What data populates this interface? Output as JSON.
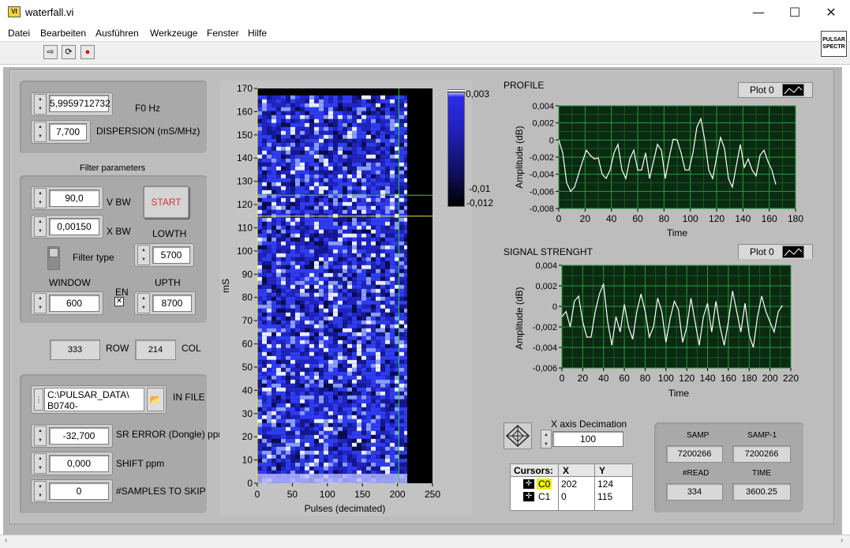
{
  "window": {
    "title": "waterfall.vi",
    "app_icon_text": "VI",
    "minimize": "—",
    "maximize": "☐",
    "close": "✕"
  },
  "menu": [
    "Datei",
    "Bearbeiten",
    "Ausführen",
    "Werkzeuge",
    "Fenster",
    "Hilfe"
  ],
  "toolbar": {
    "run": "⇨",
    "run_continuous": "⟳",
    "abort": "●"
  },
  "logo": {
    "line1": "PULSAR",
    "line2": "SPECTR"
  },
  "left": {
    "f0": {
      "value": "5,9959712732",
      "label": "F0 Hz"
    },
    "dispersion": {
      "value": "7,700",
      "label": "DISPERSION (mS/MHz)"
    },
    "filter_title": "Filter parameters",
    "vbw": {
      "value": "90,0",
      "label": "V BW"
    },
    "xbw": {
      "value": "0,00150",
      "label": "X BW"
    },
    "start": "START",
    "lowth": {
      "value": "5700",
      "label": "LOWTH"
    },
    "filter_type": "Filter type",
    "window": {
      "value": "600",
      "label": "WINDOW"
    },
    "en": {
      "label": "EN",
      "mark": "✕"
    },
    "upth": {
      "value": "8700",
      "label": "UPTH"
    },
    "row": {
      "value": "333",
      "label": "ROW"
    },
    "col": {
      "value": "214",
      "label": "COL"
    },
    "in_file": {
      "line1": "C:\\PULSAR_DATA\\",
      "line2": "B0740-",
      "label": "IN FILE",
      "browse": "📂"
    },
    "sr_error": {
      "value": "-32,700",
      "label": "SR ERROR (Dongle) ppm"
    },
    "shift": {
      "value": "0,000",
      "label": "SHIFT ppm"
    },
    "skip": {
      "value": "0",
      "label": "#SAMPLES TO SKIP"
    }
  },
  "right": {
    "profile_title": "PROFILE",
    "signal_title": "SIGNAL STRENGHT",
    "plot_legend": "Plot 0",
    "x_decimation": {
      "label": "X axis Decimation",
      "value": "100"
    },
    "cursors": {
      "headers": [
        "Cursors:",
        "X",
        "Y"
      ],
      "rows": [
        {
          "name": "C0",
          "x": "202",
          "y": "124"
        },
        {
          "name": "C1",
          "x": "0",
          "y": "115"
        }
      ]
    },
    "stats": {
      "samp_label": "SAMP",
      "samp": "7200266",
      "samp1_label": "SAMP-1",
      "samp1": "7200266",
      "read_label": "#READ",
      "read": "334",
      "time_label": "TIME",
      "time": "3600.25"
    }
  },
  "colors": {
    "panel": "#b5b5b5",
    "waterfall_blue": "#2020c8",
    "plot_bg": "#0a2a12",
    "grid": "#1e8a2e",
    "start_text": "#e03030"
  },
  "chart_data": [
    {
      "type": "heatmap",
      "title": "",
      "xlabel": "Pulses (decimated)",
      "ylabel": "mS",
      "xlim": [
        0,
        250
      ],
      "ylim": [
        0,
        170
      ],
      "x_ticks": [
        "0",
        "50",
        "100",
        "150",
        "200",
        "250"
      ],
      "y_ticks": [
        "0",
        "10",
        "20",
        "30",
        "40",
        "50",
        "60",
        "70",
        "80",
        "90",
        "100",
        "110",
        "120",
        "130",
        "140",
        "150",
        "160",
        "170"
      ],
      "data_extent": {
        "x": [
          0,
          214
        ],
        "y": [
          0,
          167
        ]
      },
      "colorbar_labels": [
        "0,003",
        "-0,01",
        "-0,012"
      ],
      "cursors": [
        {
          "x": 202,
          "y": 124,
          "color": "#30d030"
        },
        {
          "x": 0,
          "y": 115,
          "color": "#e8e850"
        }
      ]
    },
    {
      "type": "line",
      "title": "PROFILE",
      "xlabel": "Time",
      "ylabel": "Amplitude (dB)",
      "xlim": [
        0,
        180
      ],
      "ylim": [
        -0.008,
        0.004
      ],
      "x_ticks": [
        "0",
        "20",
        "40",
        "60",
        "80",
        "100",
        "120",
        "140",
        "160",
        "180"
      ],
      "y_ticks": [
        "0,004",
        "0,002",
        "0",
        "-0,002",
        "-0,004",
        "-0,006",
        "-0,008"
      ],
      "series": [
        {
          "name": "Plot 0",
          "x": [
            0,
            3,
            6,
            9,
            12,
            15,
            18,
            21,
            24,
            27,
            30,
            33,
            36,
            39,
            42,
            45,
            48,
            51,
            54,
            57,
            60,
            63,
            66,
            69,
            72,
            75,
            78,
            81,
            84,
            87,
            90,
            93,
            96,
            99,
            102,
            105,
            108,
            111,
            114,
            117,
            120,
            123,
            126,
            129,
            132,
            135,
            138,
            141,
            144,
            147,
            150,
            153,
            156,
            159,
            162,
            165
          ],
          "y": [
            0.0,
            -0.0015,
            -0.005,
            -0.006,
            -0.0055,
            -0.004,
            -0.0025,
            -0.0012,
            -0.0018,
            -0.0022,
            -0.0021,
            -0.004,
            -0.0045,
            -0.0035,
            -0.0015,
            -0.0005,
            -0.0035,
            -0.0045,
            -0.0022,
            -0.0012,
            -0.0035,
            -0.0035,
            -0.0015,
            -0.0045,
            -0.0025,
            -0.0005,
            -0.0012,
            -0.0045,
            -0.002,
            0.0001,
            0.0,
            -0.0015,
            -0.0035,
            -0.0035,
            -0.0015,
            0.0015,
            0.0025,
            0.0,
            -0.0035,
            -0.0045,
            -0.002,
            0.0003,
            -0.001,
            -0.0045,
            -0.0055,
            -0.003,
            -0.0005,
            -0.0032,
            -0.0022,
            -0.0035,
            -0.0042,
            -0.0018,
            -0.0012,
            -0.0025,
            -0.0035,
            -0.0052
          ]
        }
      ]
    },
    {
      "type": "line",
      "title": "SIGNAL STRENGHT",
      "xlabel": "Time",
      "ylabel": "Amplitude (dB)",
      "xlim": [
        0,
        220
      ],
      "ylim": [
        -0.006,
        0.004
      ],
      "x_ticks": [
        "0",
        "20",
        "40",
        "60",
        "80",
        "100",
        "120",
        "140",
        "160",
        "180",
        "200",
        "220"
      ],
      "y_ticks": [
        "0,004",
        "0,002",
        "0",
        "-0,002",
        "-0,004",
        "-0,006"
      ],
      "series": [
        {
          "name": "Plot 0",
          "x": [
            0,
            4,
            8,
            12,
            16,
            20,
            24,
            28,
            32,
            36,
            40,
            44,
            48,
            52,
            56,
            60,
            64,
            68,
            72,
            76,
            80,
            84,
            88,
            92,
            96,
            100,
            104,
            108,
            112,
            116,
            120,
            124,
            128,
            132,
            136,
            140,
            144,
            148,
            152,
            156,
            160,
            164,
            168,
            172,
            176,
            180,
            184,
            188,
            192,
            196,
            200,
            204,
            208,
            212
          ],
          "y": [
            -0.001,
            -0.0005,
            -0.002,
            0.0005,
            0.001,
            -0.0015,
            -0.003,
            -0.003,
            -0.0005,
            0.0012,
            0.0022,
            -0.0015,
            -0.0038,
            -0.001,
            -0.0025,
            0.0002,
            -0.002,
            -0.0032,
            -0.0005,
            0.0012,
            -0.0005,
            -0.003,
            -0.002,
            0.0008,
            -0.0005,
            -0.0035,
            -0.0012,
            0.0005,
            -0.0003,
            -0.0035,
            -0.002,
            0.0008,
            -0.0015,
            -0.0038,
            -0.001,
            0.0003,
            -0.0025,
            0.0005,
            -0.002,
            -0.0038,
            -0.0015,
            0.0015,
            -0.0005,
            -0.0025,
            0.0003,
            -0.0028,
            -0.004,
            -0.001,
            0.001,
            -0.0005,
            -0.0015,
            -0.0025,
            -0.0005,
            0.0001
          ]
        }
      ]
    }
  ]
}
